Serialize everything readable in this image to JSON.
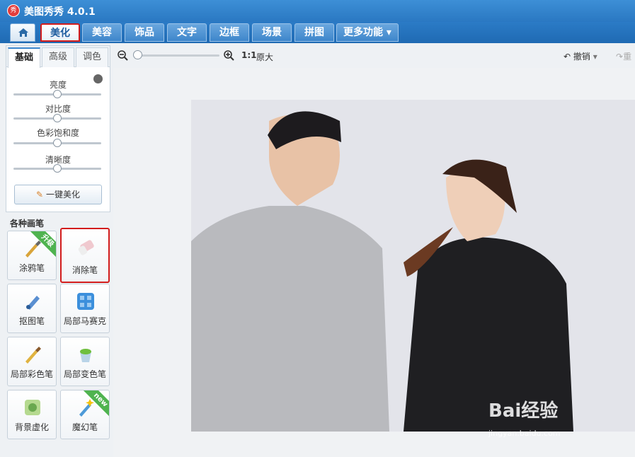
{
  "window": {
    "title": "美图秀秀 4.0.1",
    "logo_text": "秀"
  },
  "nav": {
    "tabs": [
      {
        "label": "美化",
        "active": true
      },
      {
        "label": "美容"
      },
      {
        "label": "饰品"
      },
      {
        "label": "文字"
      },
      {
        "label": "边框"
      },
      {
        "label": "场景"
      },
      {
        "label": "拼图"
      },
      {
        "label": "更多功能"
      }
    ]
  },
  "subtabs": [
    "基础",
    "高级",
    "调色"
  ],
  "adjust": {
    "sliders": [
      {
        "label": "亮度",
        "value": 0.5
      },
      {
        "label": "对比度",
        "value": 0.5
      },
      {
        "label": "色彩饱和度",
        "value": 0.5
      },
      {
        "label": "清晰度",
        "value": 0.5
      }
    ],
    "one_click_label": "一键美化"
  },
  "brushes": {
    "title": "各种画笔",
    "items": [
      {
        "label": "涂鸦笔",
        "badge": "升级"
      },
      {
        "label": "消除笔",
        "highlight": true
      },
      {
        "label": "抠图笔"
      },
      {
        "label": "局部马赛克"
      },
      {
        "label": "局部彩色笔"
      },
      {
        "label": "局部变色笔"
      },
      {
        "label": "背景虚化"
      },
      {
        "label": "魔幻笔",
        "badge": "new"
      }
    ]
  },
  "toolbar": {
    "ratio": "1:1",
    "original": "原大",
    "undo": "撤销",
    "redo": "重",
    "zoom_value": 0.0
  },
  "watermark": {
    "brand": "Bai经验",
    "url": "jingyan.baidu.com"
  },
  "colors": {
    "title_bar": "#2a78c2",
    "highlight_border": "#d21c1c",
    "active_tab": "#1f5ea0"
  }
}
